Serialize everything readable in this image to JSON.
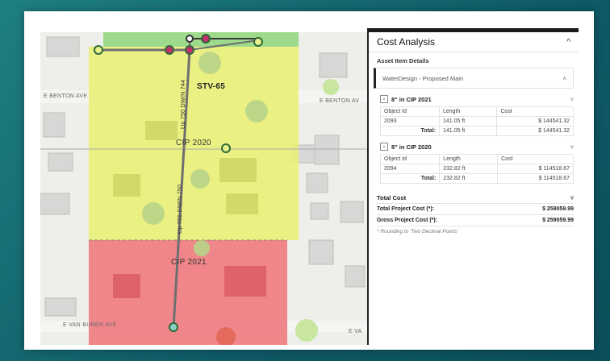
{
  "map": {
    "streets": [
      "E BENTON AVE",
      "E BENTON AV",
      "E VAN BUREN AVE",
      "E VA"
    ],
    "zones": [
      "STV-65",
      "CIP 2020",
      "CIP 2021"
    ],
    "pipe_labels": [
      "Up 750 DWIN 744",
      "Up 755 DWIN 750"
    ],
    "colors": {
      "yellow_zone": "#eaf078",
      "red_zone": "#f07a80",
      "green_zone": "#8ed67a",
      "pipe": "#6f6f6f"
    }
  },
  "panel": {
    "title": "Cost Analysis",
    "section": "Asset Item Details",
    "asset": "WaterDesign - Proposed Main",
    "groups": [
      {
        "title": "8\" in CIP 2021",
        "headers": [
          "Object Id",
          "Length",
          "Cost"
        ],
        "row": [
          "2093",
          "141.05 ft",
          "$ 144541.32"
        ],
        "total_label": "Total:",
        "total_length": "141.05 ft",
        "total_cost": "$ 144541.32"
      },
      {
        "title": "8\" in CIP 2020",
        "headers": [
          "Object Id",
          "Length",
          "Cost"
        ],
        "row": [
          "2094",
          "232.82 ft",
          "$ 114518.67"
        ],
        "total_label": "Total:",
        "total_length": "232.82 ft",
        "total_cost": "$ 114518.67"
      }
    ],
    "totals": {
      "heading": "Total Cost",
      "project_label": "Total Project Cost (*):",
      "project_value": "$ 259059.99",
      "gross_label": "Gross Project Cost (*):",
      "gross_value": "$ 259059.99",
      "note": "* Rounding to 'Two Decimal Points'"
    }
  }
}
